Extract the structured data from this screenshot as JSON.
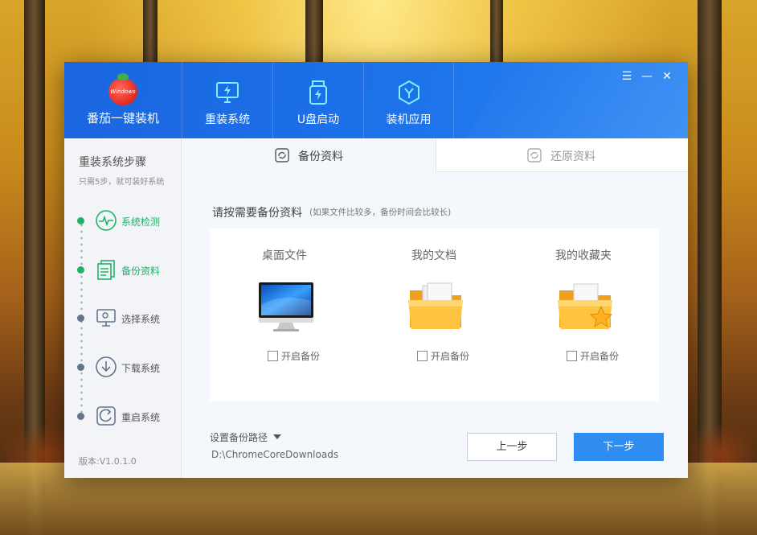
{
  "app": {
    "name": "番茄一键装机",
    "logo_text": "Windows"
  },
  "nav": [
    {
      "label": "重装系统",
      "icon": "monitor-reinstall-icon"
    },
    {
      "label": "U盘启动",
      "icon": "usb-drive-icon"
    },
    {
      "label": "装机应用",
      "icon": "hexagon-app-icon"
    }
  ],
  "window_controls": {
    "menu": "☰",
    "minimize": "—",
    "close": "✕"
  },
  "sidebar": {
    "title": "重装系统步骤",
    "subtitle": "只需5步，就可装好系统",
    "steps": [
      {
        "label": "系统检测",
        "icon": "pulse-check-icon",
        "active": true
      },
      {
        "label": "备份资料",
        "icon": "document-copy-icon",
        "active": true
      },
      {
        "label": "选择系统",
        "icon": "monitor-select-icon",
        "active": false
      },
      {
        "label": "下载系统",
        "icon": "download-icon",
        "active": false
      },
      {
        "label": "重启系统",
        "icon": "restart-icon",
        "active": false
      }
    ],
    "version": "版本:V1.0.1.0"
  },
  "tabs": [
    {
      "label": "备份资料",
      "icon": "backup-icon",
      "active": true
    },
    {
      "label": "还原资料",
      "icon": "restore-icon",
      "active": false
    }
  ],
  "content": {
    "prompt": "请按需要备份资料",
    "prompt_note": "(如果文件比较多，备份时间会比较长)",
    "items": [
      {
        "title": "桌面文件",
        "icon": "desktop-monitor-icon",
        "checkbox_label": "开启备份",
        "checked": false
      },
      {
        "title": "我的文档",
        "icon": "documents-folder-icon",
        "checkbox_label": "开启备份",
        "checked": false
      },
      {
        "title": "我的收藏夹",
        "icon": "favorites-folder-icon",
        "checkbox_label": "开启备份",
        "checked": false
      }
    ],
    "path_label": "设置备份路径",
    "path_value": "D:\\ChromeCoreDownloads",
    "prev_button": "上一步",
    "next_button": "下一步"
  },
  "colors": {
    "header_blue": "#1d72ea",
    "active_green": "#1fb368",
    "next_button": "#2f8cf0"
  }
}
